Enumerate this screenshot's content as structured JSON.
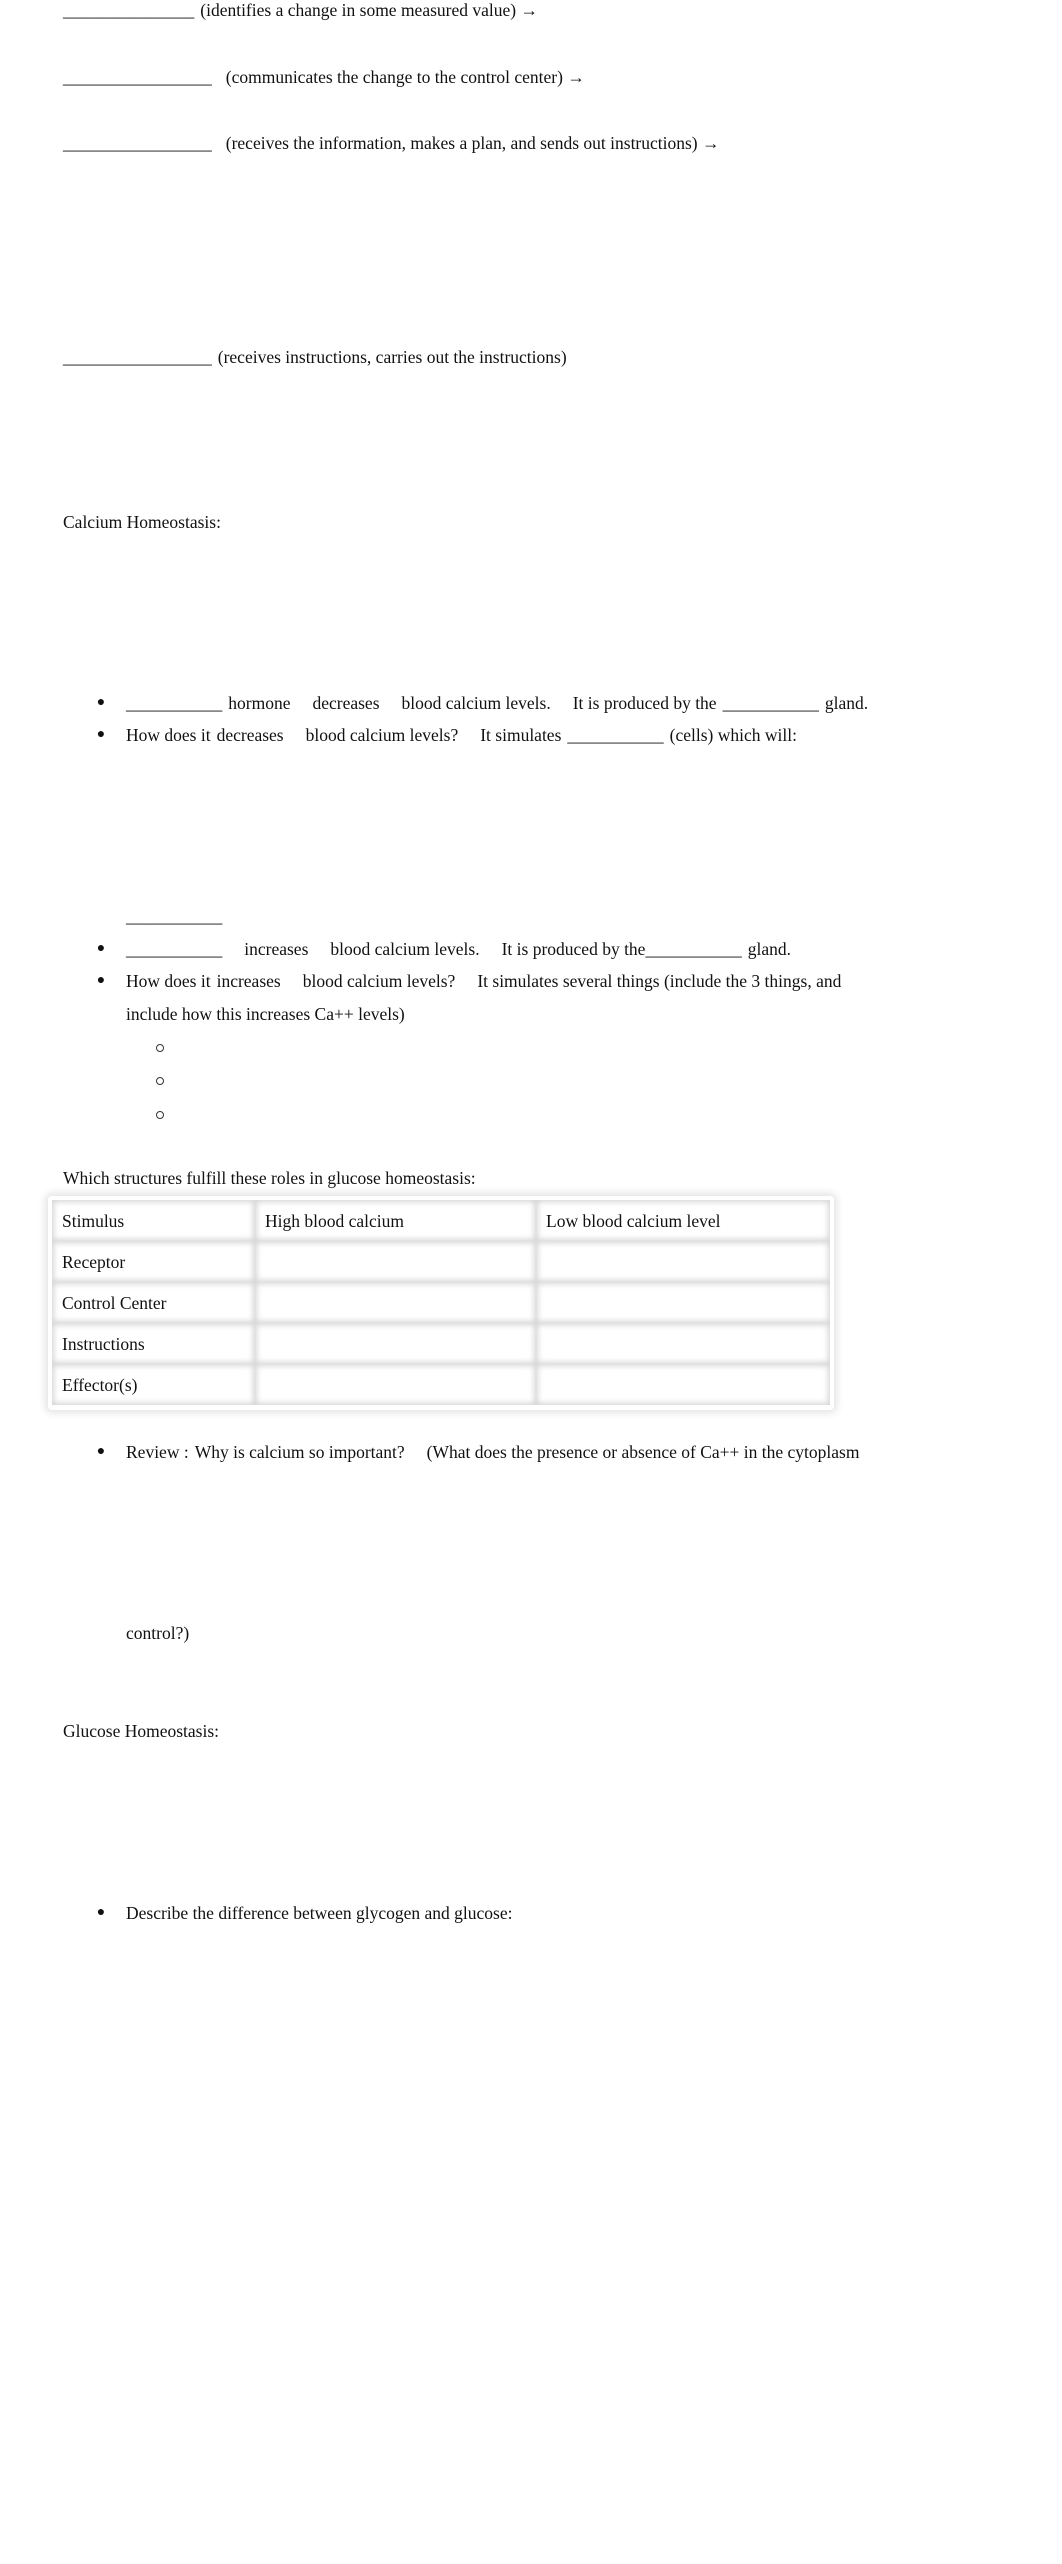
{
  "feedback_loop": {
    "lines": [
      {
        "blank": "_______________",
        "text": "(identifies a change in some measured value) →"
      },
      {
        "blank": "_________________",
        "text": "(communicates the change to the control center) →"
      },
      {
        "blank": "_________________",
        "text": "(receives the information, makes a plan, and sends out instructions) →"
      },
      {
        "blank": "_________________",
        "text": "(receives instructions, carries out the instructions)"
      }
    ]
  },
  "calcium": {
    "heading": "Calcium Homeostasis:",
    "bullets": [
      {
        "parts": [
          "___________",
          "hormone",
          "decreases",
          "blood calcium levels.",
          "It is produced by the",
          "___________",
          "gland."
        ]
      },
      {
        "parts": [
          "How does it",
          "decreases",
          "blood calcium levels?",
          "It simulates",
          "___________",
          "(cells) which will:"
        ]
      },
      {
        "parts": [
          "___________",
          "increases",
          "blood calcium levels.",
          "It is produced by the",
          "___________",
          "gland."
        ]
      },
      {
        "parts": [
          "How does it",
          "increases",
          "blood calcium levels?",
          "It simulates several things (include the 3 things, and"
        ],
        "continuation": "include how this increases Ca++ levels)"
      }
    ],
    "answer_blank": "___________",
    "sub_bullets": [
      "",
      "",
      ""
    ]
  },
  "table_section": {
    "caption": "Which structures fulfill these roles in glucose homeostasis:",
    "rows": [
      [
        "Stimulus",
        "High blood calcium",
        "Low blood calcium level"
      ],
      [
        "Receptor",
        "",
        ""
      ],
      [
        "Control Center",
        "",
        ""
      ],
      [
        "Instructions",
        "",
        ""
      ],
      [
        "Effector(s)",
        "",
        ""
      ]
    ]
  },
  "review": {
    "parts": [
      "Review :",
      "Why is calcium so important?",
      "(What does the presence or absence of Ca++ in the cytoplasm"
    ],
    "continuation": "control?)"
  },
  "glucose": {
    "heading": "Glucose Homeostasis:",
    "bullets": [
      "Describe the difference between glycogen and glucose:"
    ]
  },
  "symbols": {
    "bullet": "●"
  }
}
